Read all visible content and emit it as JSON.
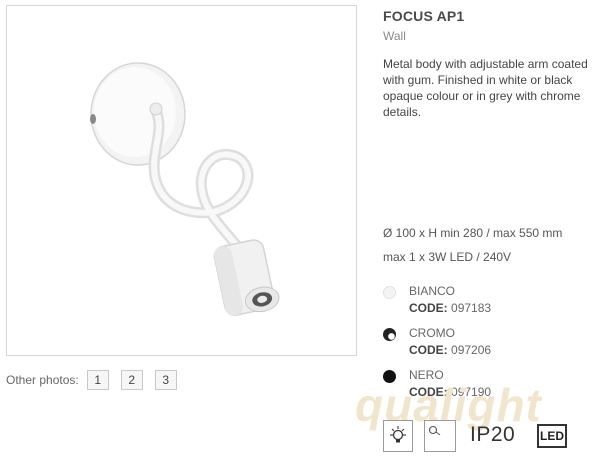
{
  "product": {
    "title": "FOCUS AP1",
    "category": "Wall",
    "description": "Metal body with adjustable arm coated with gum. Finished in white or black opaque colour or in grey with chrome details.",
    "dimensions": "Ø 100 x H min 280 / max 550 mm",
    "lamp": "max 1 x 3W LED / 240V"
  },
  "gallery": {
    "other_photos_label": "Other photos:",
    "pages": [
      "1",
      "2",
      "3"
    ]
  },
  "variants": [
    {
      "name": "BIANCO",
      "code_label": "CODE:",
      "code": "097183",
      "color": "#f4f4f4"
    },
    {
      "name": "CROMO",
      "code_label": "CODE:",
      "code": "097206",
      "color": "#555555"
    },
    {
      "name": "NERO",
      "code_label": "CODE:",
      "code": "097190",
      "color": "#111111"
    }
  ],
  "certifications": {
    "ip_rating": "IP20",
    "led_mark": "LED"
  },
  "watermark": "qualight",
  "icons": [
    "lightbulb-icon",
    "lamp-orientation-icon"
  ]
}
